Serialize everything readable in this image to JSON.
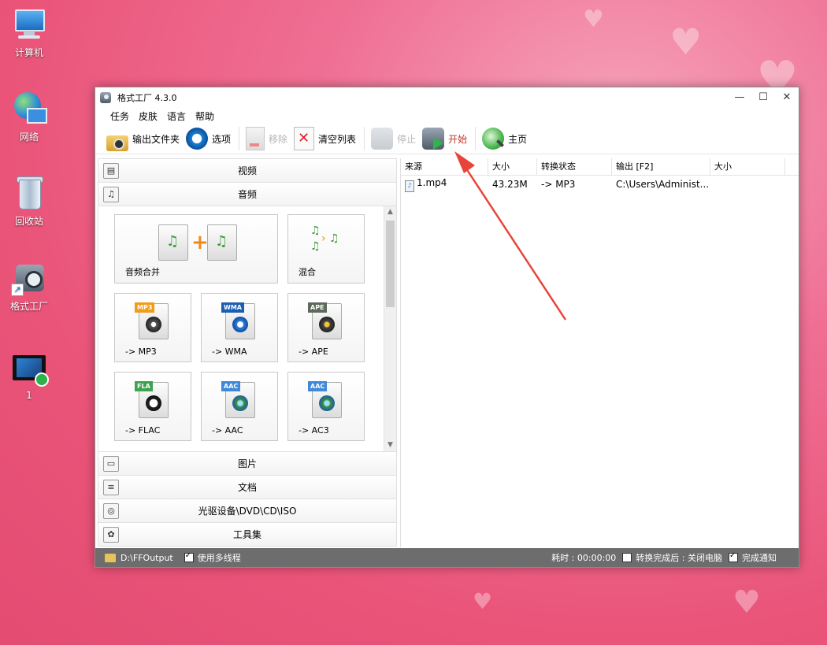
{
  "desktop": {
    "icons": [
      {
        "label": "计算机",
        "icon": "computer-icon"
      },
      {
        "label": "网络",
        "icon": "network-icon"
      },
      {
        "label": "回收站",
        "icon": "recycle-bin-icon"
      },
      {
        "label": "格式工厂",
        "icon": "format-factory-shortcut-icon"
      },
      {
        "label": "1",
        "icon": "video-file-icon"
      }
    ]
  },
  "window": {
    "title": "格式工厂 4.3.0",
    "controls": {
      "minimize": "—",
      "maximize": "☐",
      "close": "✕"
    }
  },
  "menu": [
    "任务",
    "皮肤",
    "语言",
    "帮助"
  ],
  "toolbar": {
    "output_folder": "输出文件夹",
    "options": "选项",
    "remove": "移除",
    "clear_list": "清空列表",
    "stop": "停止",
    "start": "开始",
    "home": "主页"
  },
  "categories_top": [
    {
      "label": "视频",
      "icon": "video-category-icon",
      "glyph": "▤"
    },
    {
      "label": "音频",
      "icon": "audio-category-icon",
      "glyph": "♫"
    }
  ],
  "audio_tiles": [
    {
      "label": "音频合并"
    },
    {
      "label": "混合"
    },
    {
      "label": "-> MP3",
      "tag": "MP3"
    },
    {
      "label": "-> WMA",
      "tag": "WMA"
    },
    {
      "label": "-> APE",
      "tag": "APE"
    },
    {
      "label": "-> FLAC",
      "tag": "FLA"
    },
    {
      "label": "-> AAC",
      "tag": "AAC"
    },
    {
      "label": "-> AC3",
      "tag": "AAC"
    }
  ],
  "categories_bottom": [
    {
      "label": "图片",
      "icon": "image-category-icon",
      "glyph": "▭"
    },
    {
      "label": "文档",
      "icon": "document-category-icon",
      "glyph": "≡"
    },
    {
      "label": "光驱设备\\DVD\\CD\\ISO",
      "icon": "disc-drive-category-icon",
      "glyph": "◎"
    },
    {
      "label": "工具集",
      "icon": "toolbox-category-icon",
      "glyph": "✿"
    }
  ],
  "file_list": {
    "headers": [
      "来源",
      "大小",
      "转换状态",
      "输出 [F2]",
      "大小"
    ],
    "rows": [
      {
        "source": "1.mp4",
        "size": "43.23M",
        "status": "-> MP3",
        "output": "C:\\Users\\Administ...",
        "out_size": ""
      }
    ]
  },
  "statusbar": {
    "output_path": "D:\\FFOutput",
    "multithread_label": "使用多线程",
    "multithread_checked": true,
    "elapsed": "耗时 : 00:00:00",
    "after_convert_label": "转换完成后 : 关闭电脑",
    "after_convert_checked": false,
    "notify_label": "完成通知",
    "notify_checked": true
  },
  "colors": {
    "desktop_bg": "#ea5479",
    "statusbar_bg": "#6d6d6d",
    "annotation_arrow": "#e8443a",
    "start_text": "#c0392b"
  }
}
